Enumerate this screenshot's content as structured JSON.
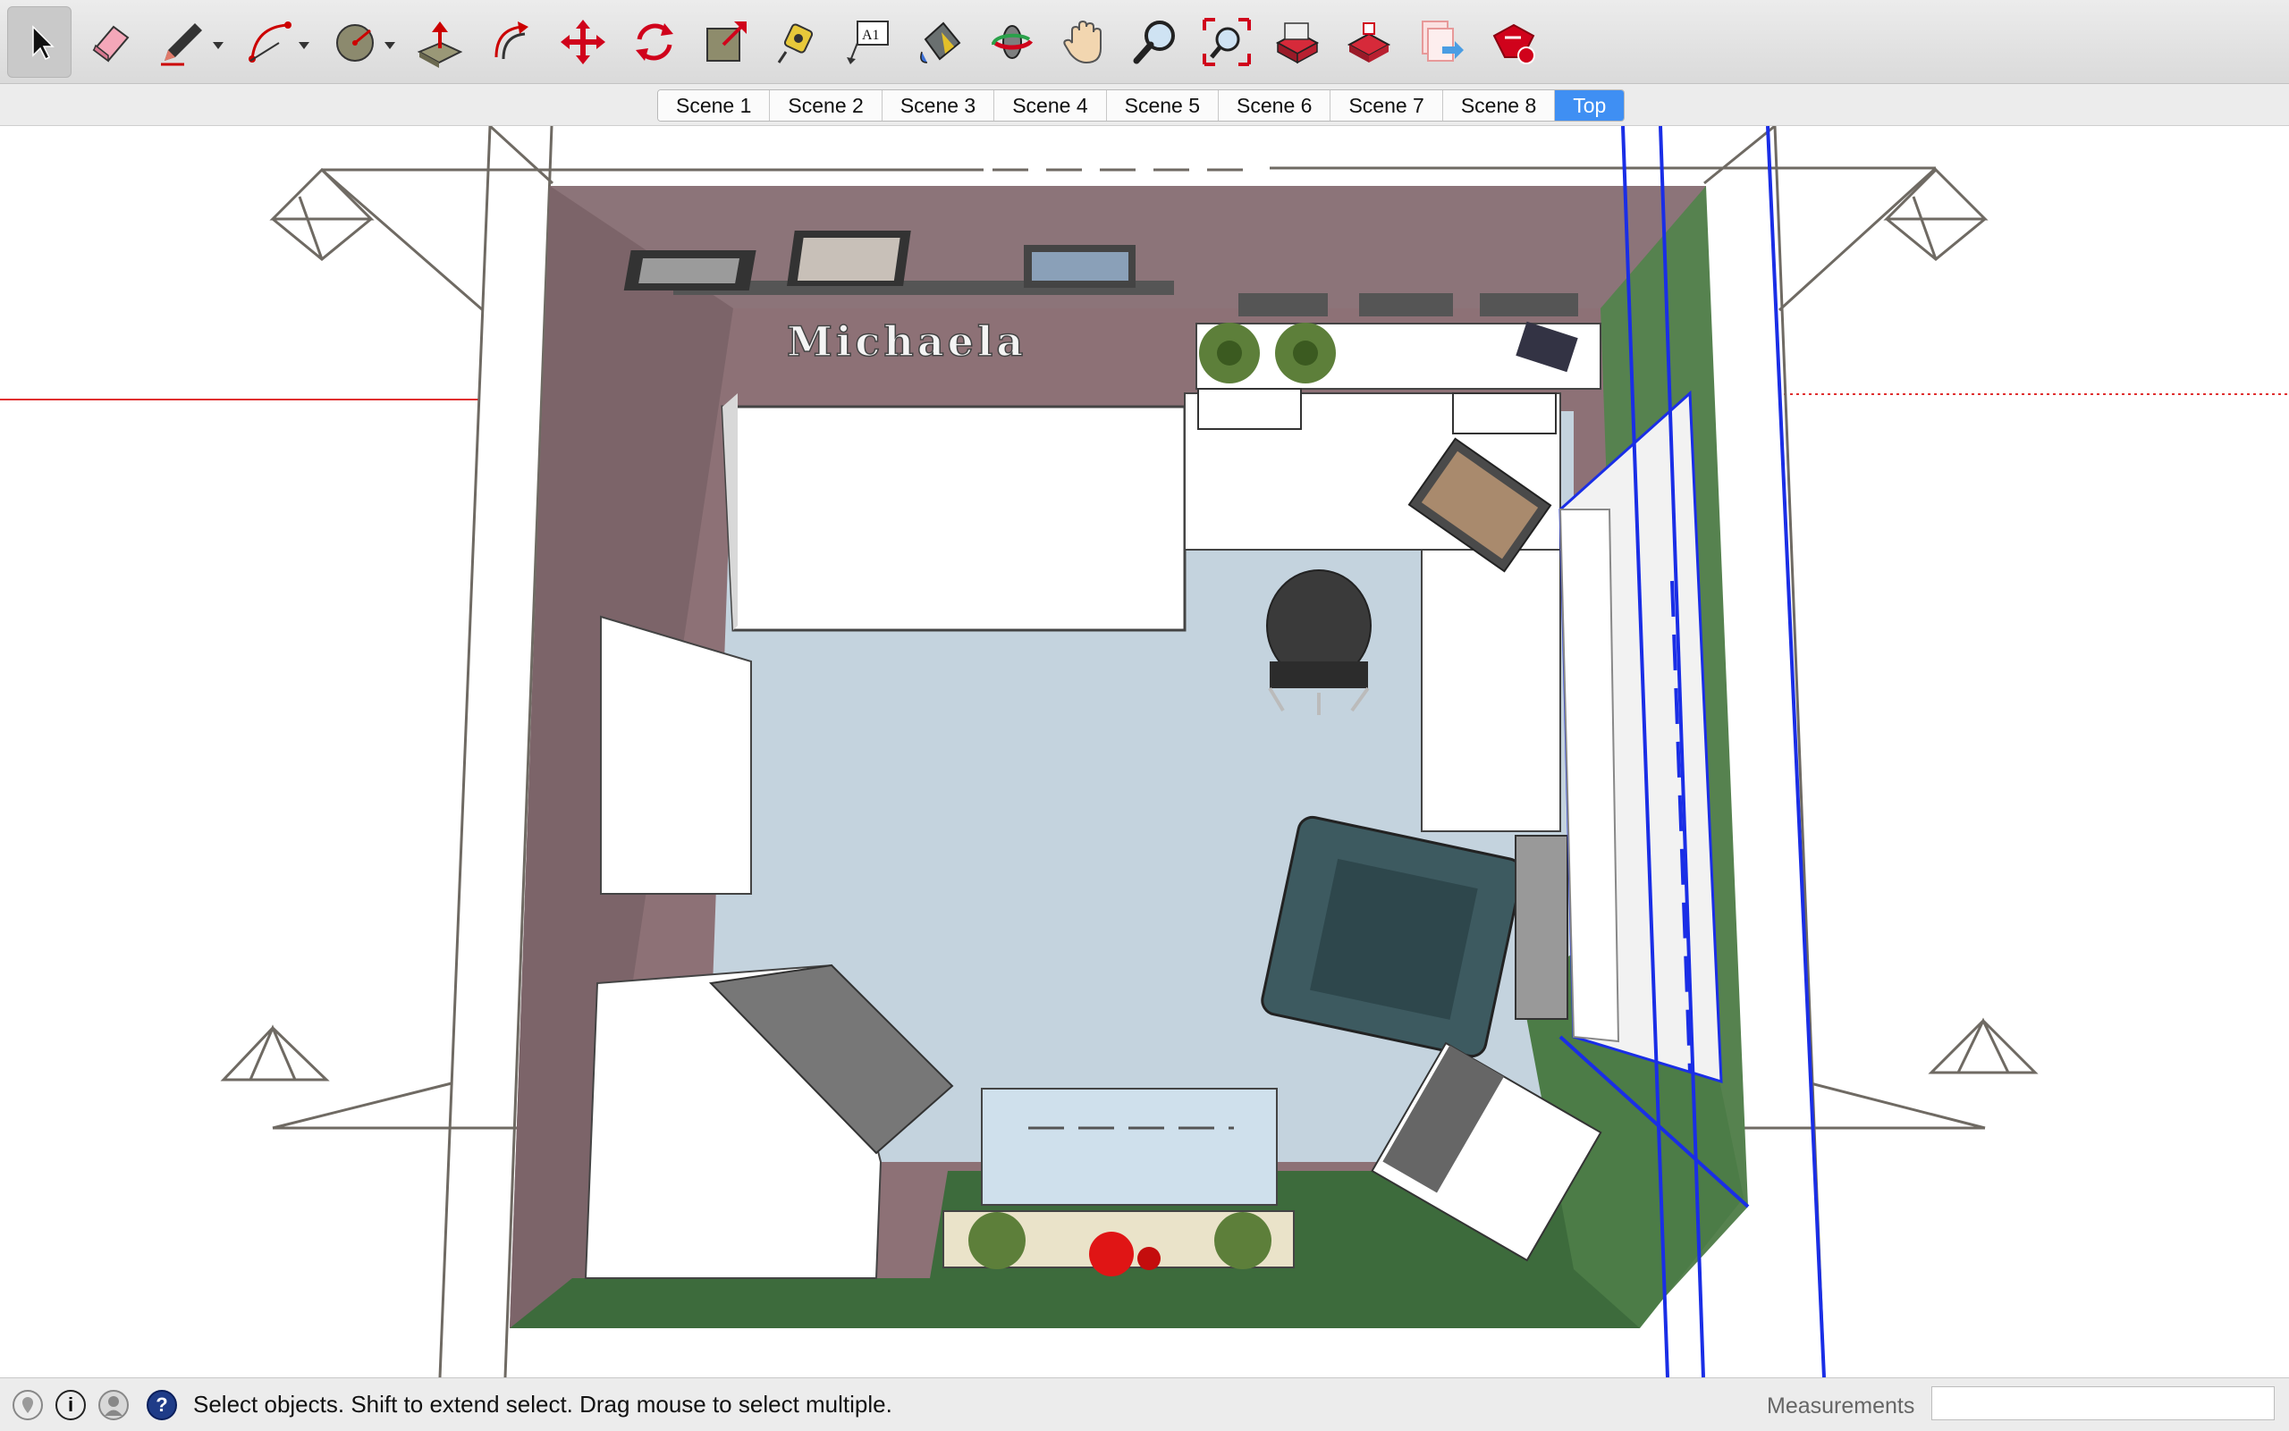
{
  "toolbar": {
    "tools": [
      {
        "name": "select-tool-icon",
        "label": "Select",
        "active": true
      },
      {
        "name": "eraser-tool-icon",
        "label": "Eraser"
      },
      {
        "name": "pencil-line-tool-icon",
        "label": "Line"
      },
      {
        "name": "arc-tool-icon",
        "label": "Arc"
      },
      {
        "name": "shape-tool-icon",
        "label": "Shapes"
      },
      {
        "name": "push-pull-tool-icon",
        "label": "Push/Pull"
      },
      {
        "name": "offset-tool-icon",
        "label": "Offset"
      },
      {
        "name": "move-tool-icon",
        "label": "Move"
      },
      {
        "name": "rotate-tool-icon",
        "label": "Rotate"
      },
      {
        "name": "scale-tool-icon",
        "label": "Scale"
      },
      {
        "name": "tape-measure-tool-icon",
        "label": "Tape Measure"
      },
      {
        "name": "text-tool-icon",
        "label": "Text",
        "glyph": "A1"
      },
      {
        "name": "paint-bucket-tool-icon",
        "label": "Paint Bucket"
      },
      {
        "name": "orbit-tool-icon",
        "label": "Orbit"
      },
      {
        "name": "pan-tool-icon",
        "label": "Pan"
      },
      {
        "name": "zoom-tool-icon",
        "label": "Zoom"
      },
      {
        "name": "zoom-extents-tool-icon",
        "label": "Zoom Extents"
      },
      {
        "name": "warehouse-tool-icon",
        "label": "3D Warehouse"
      },
      {
        "name": "extension-warehouse-tool-icon",
        "label": "Extension Warehouse"
      },
      {
        "name": "send-to-layout-tool-icon",
        "label": "Send to LayOut"
      },
      {
        "name": "extension-manager-tool-icon",
        "label": "Extension Manager"
      }
    ]
  },
  "scenes": {
    "tabs": [
      "Scene 1",
      "Scene 2",
      "Scene 3",
      "Scene 4",
      "Scene 5",
      "Scene 6",
      "Scene 7",
      "Scene 8",
      "Top"
    ],
    "active_index": 8
  },
  "model": {
    "wall_name_text": "Michaela"
  },
  "statusbar": {
    "icons": [
      "geo-location-icon",
      "credits-icon",
      "user-account-icon",
      "help-icon"
    ],
    "help_glyph": "?",
    "credits_glyph": "i",
    "message": "Select objects. Shift to extend select. Drag mouse to select multiple.",
    "measurements_label": "Measurements",
    "measurements_value": ""
  },
  "colors": {
    "wall_mauve": "#8d7176",
    "floor_blue": "#c4d3de",
    "grass_green": "#3d6b3c",
    "selection_blue": "#1a2ee6",
    "tab_active": "#3f8ff3"
  }
}
